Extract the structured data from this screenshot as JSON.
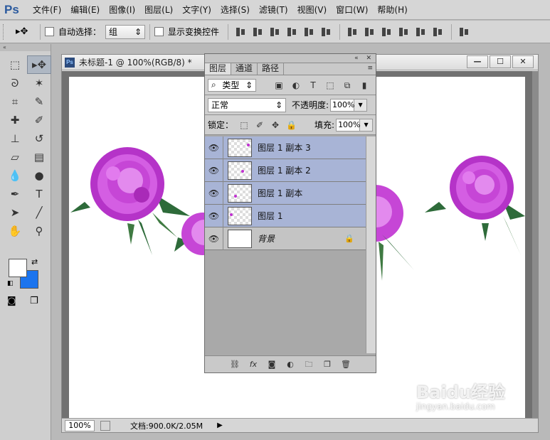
{
  "app": {
    "logo": "Ps"
  },
  "menu": [
    "文件(F)",
    "编辑(E)",
    "图像(I)",
    "图层(L)",
    "文字(Y)",
    "选择(S)",
    "滤镜(T)",
    "视图(V)",
    "窗口(W)",
    "帮助(H)"
  ],
  "options": {
    "auto_select_label": "自动选择：",
    "auto_select_value": "组",
    "show_transform_label": "显示变换控件"
  },
  "document": {
    "title": "未标题-1 @ 100%(RGB/8) *",
    "icon_label": "Ps",
    "zoom": "100%",
    "doc_info": "文档:900.0K/2.05M"
  },
  "colors": {
    "foreground": "#ffffff",
    "background": "#1b74ee",
    "accent": "#a8b4d6"
  },
  "layers_panel": {
    "tabs": [
      "图层",
      "通道",
      "路径"
    ],
    "filter_type": "类型",
    "blend_mode": "正常",
    "opacity_label": "不透明度:",
    "opacity_value": "100%",
    "lock_label": "锁定：",
    "fill_label": "填充:",
    "fill_value": "100%",
    "layers": [
      {
        "name": "图层 1 副本 3"
      },
      {
        "name": "图层 1 副本 2"
      },
      {
        "name": "图层 1 副本"
      },
      {
        "name": "图层 1"
      },
      {
        "name": "背景"
      }
    ]
  },
  "watermark": {
    "main": "Baidu经验",
    "sub": "jingyan.baidu.com"
  }
}
